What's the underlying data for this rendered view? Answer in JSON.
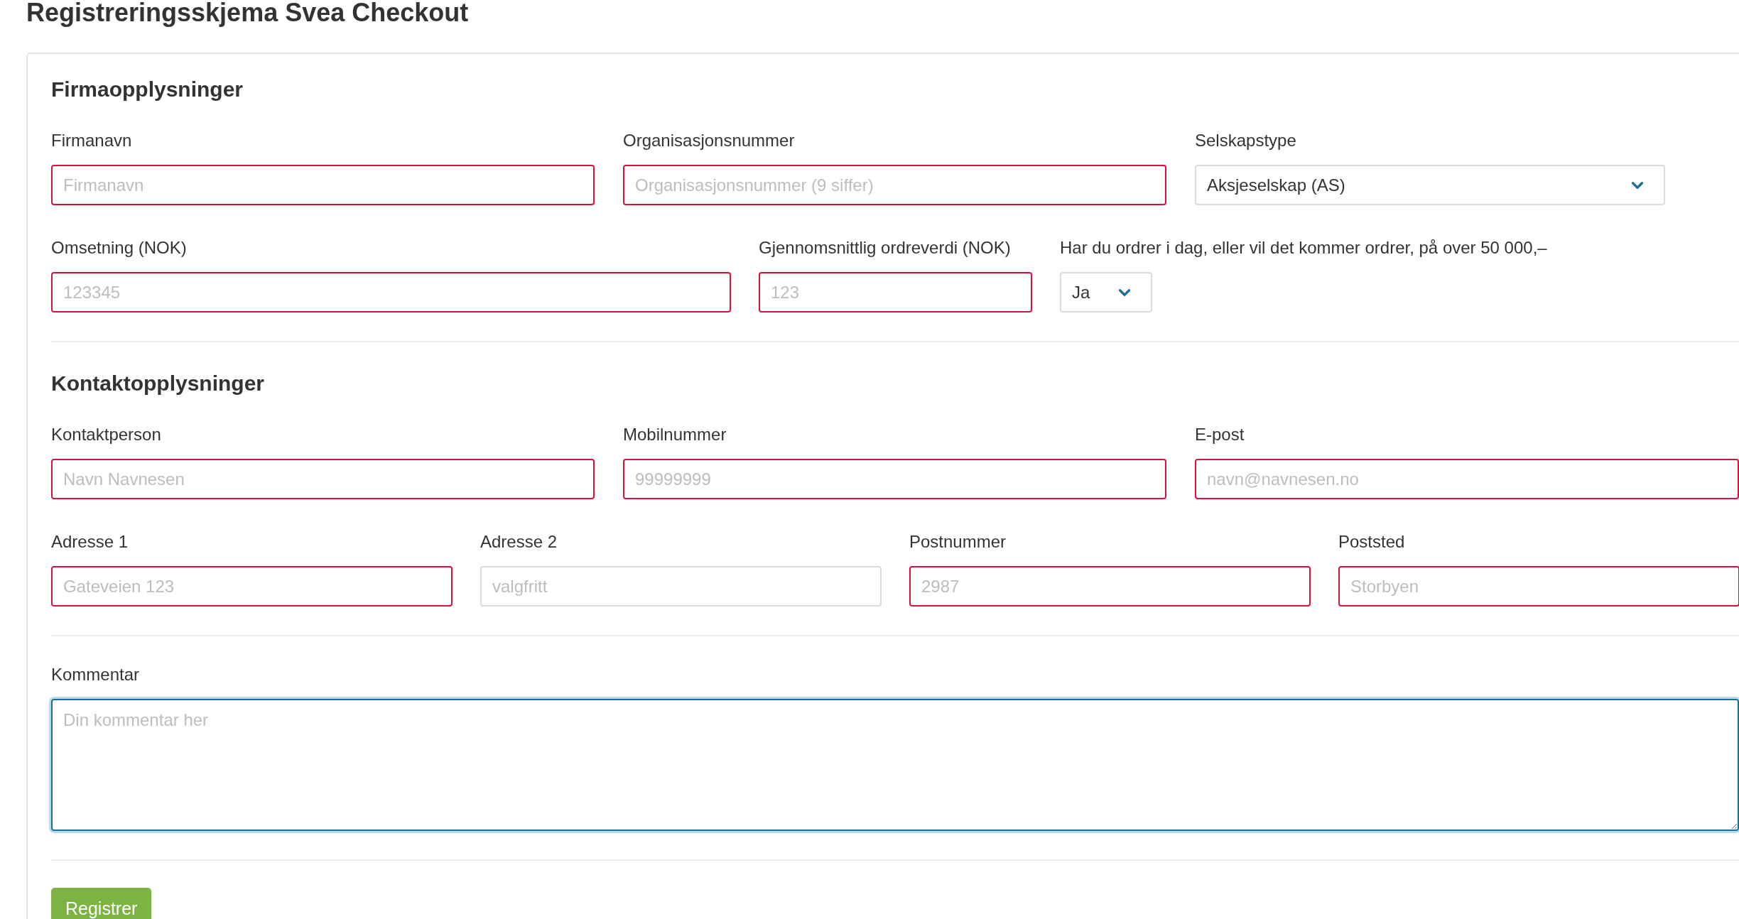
{
  "page_title": "Registreringsskjema Svea Checkout",
  "sections": [
    {
      "title": "Firmaopplysninger",
      "rows": [
        [
          {
            "kind": "text",
            "label": "Firmanavn",
            "placeholder": "Firmanavn",
            "invalid": true
          },
          {
            "kind": "text",
            "label": "Organisasjonsnummer",
            "placeholder": "Organisasjonsnummer (9 siffer)",
            "invalid": true
          },
          {
            "kind": "select",
            "label": "Selskapstype",
            "value": "Aksjeselskap (AS)"
          }
        ],
        [
          {
            "kind": "text",
            "label": "Omsetning (NOK)",
            "placeholder": "123345",
            "invalid": true
          },
          {
            "kind": "text",
            "label": "Gjennomsnittlig ordreverdi (NOK)",
            "placeholder": "123",
            "invalid": true
          },
          {
            "kind": "select",
            "label": "Har du ordrer i dag, eller vil det kommer ordrer, på over 50 000,–",
            "value": "Ja"
          }
        ]
      ]
    },
    {
      "title": "Kontaktopplysninger",
      "rows": [
        [
          {
            "kind": "text",
            "label": "Kontaktperson",
            "placeholder": "Navn Navnesen",
            "invalid": true
          },
          {
            "kind": "text",
            "label": "Mobilnummer",
            "placeholder": "99999999",
            "invalid": true
          },
          {
            "kind": "text",
            "label": "E-post",
            "placeholder": "navn@navnesen.no",
            "invalid": true
          }
        ],
        [
          {
            "kind": "text",
            "label": "Adresse 1",
            "placeholder": "Gateveien 123",
            "invalid": true
          },
          {
            "kind": "text",
            "label": "Adresse 2",
            "placeholder": "valgfritt",
            "invalid": false
          },
          {
            "kind": "text",
            "label": "Postnummer",
            "placeholder": "2987",
            "invalid": true
          },
          {
            "kind": "text",
            "label": "Poststed",
            "placeholder": "Storbyen",
            "invalid": true
          }
        ]
      ]
    },
    {
      "rows": [
        [
          {
            "kind": "textarea",
            "label": "Kommentar",
            "placeholder": "Din kommentar her",
            "focused": true
          }
        ]
      ]
    }
  ],
  "submit_button": "Registrer"
}
